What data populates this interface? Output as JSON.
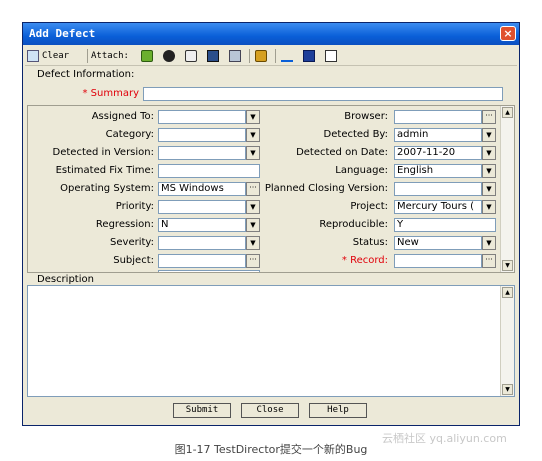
{
  "window": {
    "title": "Add Defect",
    "close_glyph": "×"
  },
  "toolbar": {
    "clear_label": "Clear",
    "attach_label": "Attach:",
    "icons": [
      "attach-file-icon",
      "attach-url-icon",
      "attach-snapshot-icon",
      "attach-sysinfo-icon",
      "attach-clipboard-icon",
      "find-similar-icon",
      "spell-check-icon",
      "thesaurus-icon",
      "spelling-options-icon"
    ]
  },
  "form": {
    "defect_info_label": "Defect Information:",
    "summary_label": "* Summary",
    "summary_value": "",
    "left": [
      {
        "label": "Assigned To:",
        "value": "",
        "control": "dropdown"
      },
      {
        "label": "Category:",
        "value": "",
        "control": "dropdown"
      },
      {
        "label": "Detected in Version:",
        "value": "",
        "control": "dropdown"
      },
      {
        "label": "Estimated Fix Time:",
        "value": "",
        "control": "text"
      },
      {
        "label": "Operating System:",
        "value": "MS Windows",
        "control": "browse"
      },
      {
        "label": "Priority:",
        "value": "",
        "control": "dropdown"
      },
      {
        "label": "Regression:",
        "value": "N",
        "control": "dropdown"
      },
      {
        "label": "Severity:",
        "value": "",
        "control": "dropdown"
      },
      {
        "label": "Subject:",
        "value": "",
        "control": "browse"
      }
    ],
    "right": [
      {
        "label": "Browser:",
        "value": "",
        "control": "browse"
      },
      {
        "label": "Detected By:",
        "value": "admin",
        "control": "dropdown"
      },
      {
        "label": "Detected on Date:",
        "value": "2007-11-20",
        "control": "dropdown"
      },
      {
        "label": "Language:",
        "value": "English",
        "control": "dropdown"
      },
      {
        "label": "Planned Closing Version:",
        "value": "",
        "control": "dropdown"
      },
      {
        "label": "Project:",
        "value": "Mercury Tours (",
        "control": "dropdown"
      },
      {
        "label": "Reproducible:",
        "value": "Y",
        "control": "text"
      },
      {
        "label": "Status:",
        "value": "New",
        "control": "dropdown"
      },
      {
        "label": "* Record:",
        "value": "",
        "control": "browse"
      }
    ],
    "description_label": "Description"
  },
  "buttons": {
    "submit": "Submit",
    "close": "Close",
    "help": "Help"
  },
  "caption": "图1-17 TestDirector提交一个新的Bug",
  "watermark": "云栖社区 yq.aliyun.com",
  "colors": {
    "title_bar": "#0A5FD8",
    "required_label": "#E0000A",
    "window_bg": "#ECE9D8"
  }
}
